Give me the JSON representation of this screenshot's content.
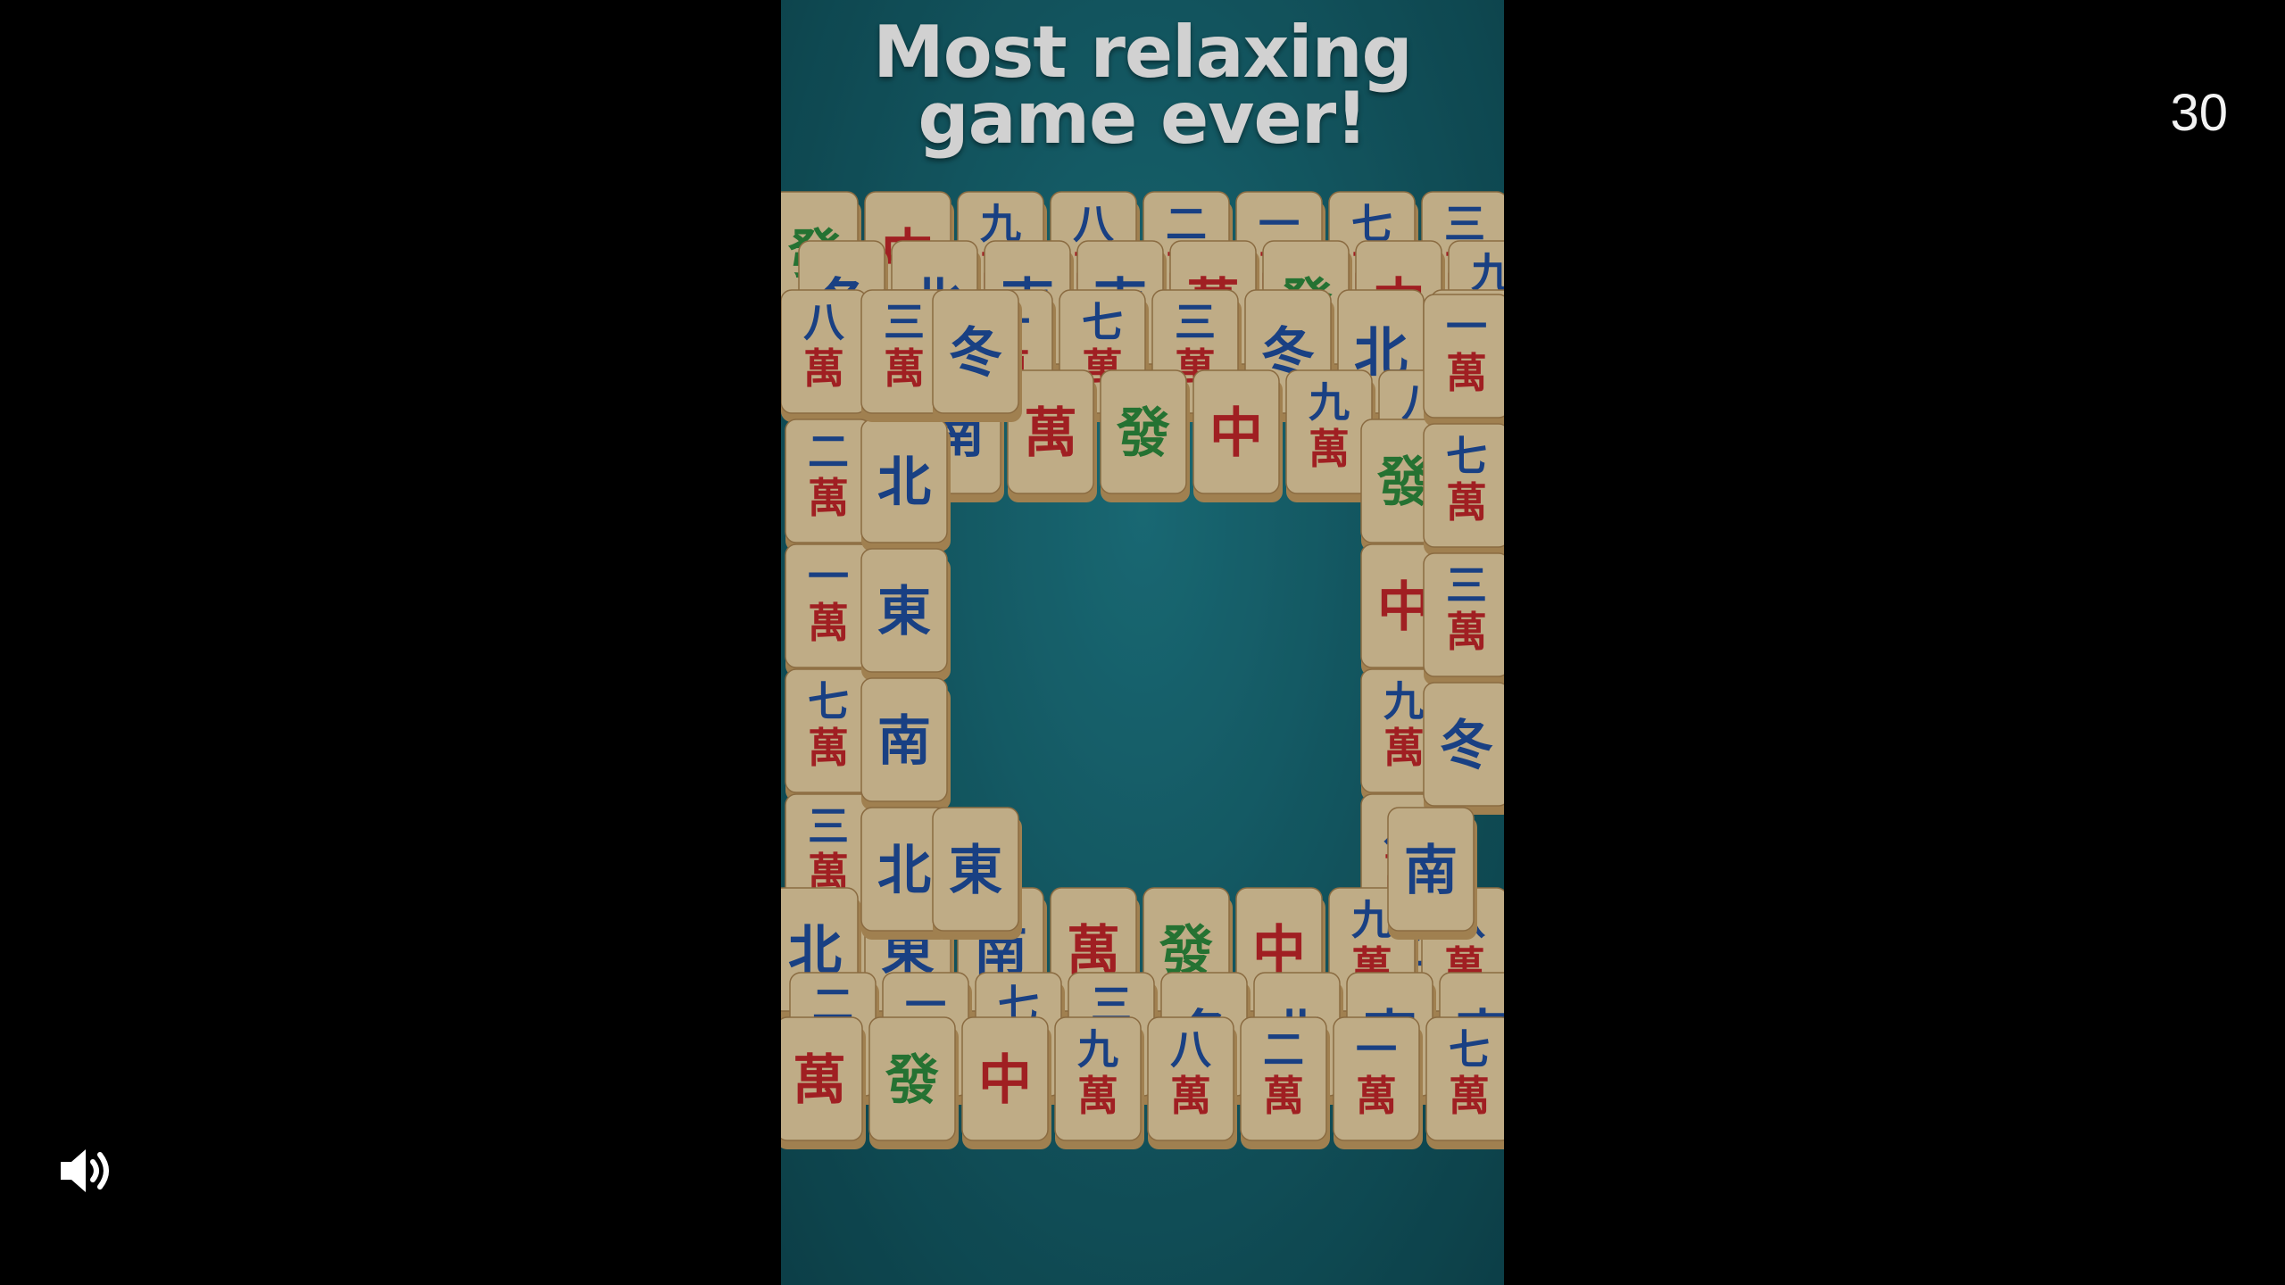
{
  "video": {
    "headline_line1": "Most relaxing",
    "headline_line2": "game ever!"
  },
  "overlay": {
    "countdown": "30",
    "sound_icon": "speaker-volume-icon"
  },
  "colors": {
    "table": "#176874",
    "tile_face": "#e9d2a4",
    "tile_side": "#c49d62",
    "blue": "#1f4fa0",
    "red": "#c4262a",
    "green": "#2e8b3e"
  },
  "tiles": [
    {
      "glyph": "發",
      "color": "green"
    },
    {
      "glyph": "中",
      "color": "red"
    },
    {
      "glyph": "九萬",
      "color": "blue"
    },
    {
      "glyph": "八萬",
      "color": "blue"
    },
    {
      "glyph": "二萬",
      "color": "blue"
    },
    {
      "glyph": "一萬",
      "color": "blue"
    },
    {
      "glyph": "七萬",
      "color": "blue"
    },
    {
      "glyph": "三萬",
      "color": "blue"
    },
    {
      "glyph": "冬",
      "color": "blue"
    },
    {
      "glyph": "北",
      "color": "blue"
    },
    {
      "glyph": "東",
      "color": "blue"
    },
    {
      "glyph": "南",
      "color": "blue"
    },
    {
      "glyph": "萬",
      "color": "red"
    }
  ]
}
